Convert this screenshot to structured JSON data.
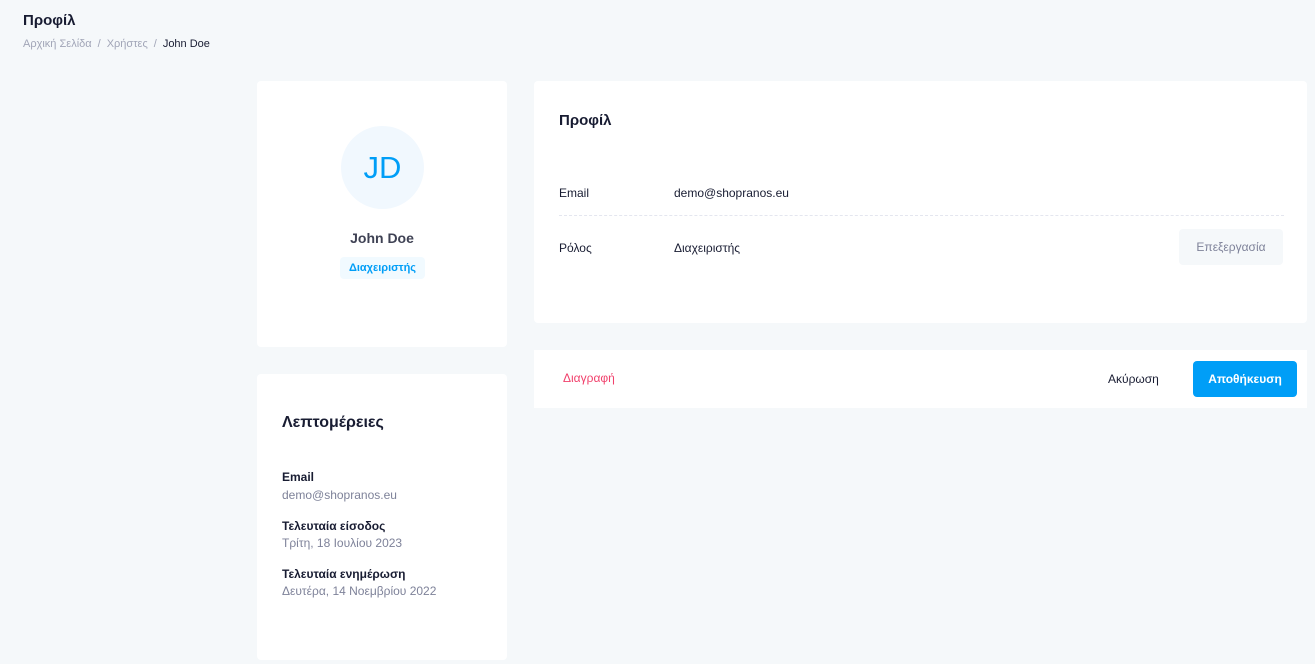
{
  "header": {
    "title": "Προφίλ",
    "breadcrumb": {
      "home": "Αρχική Σελίδα",
      "users": "Χρήστες",
      "current": "John Doe",
      "separator": "/"
    }
  },
  "user_card": {
    "initials": "JD",
    "name": "John Doe",
    "role_badge": "Διαχειριστής"
  },
  "details_card": {
    "title": "Λεπτομέρειες",
    "email_label": "Email",
    "email_value": "demo@shopranos.eu",
    "last_login_label": "Τελευταία είσοδος",
    "last_login_value": "Τρίτη, 18 Ιουλίου 2023",
    "last_update_label": "Τελευταία ενημέρωση",
    "last_update_value": "Δευτέρα, 14 Νοεμβρίου 2022"
  },
  "profile_card": {
    "title": "Προφίλ",
    "email_label": "Email",
    "email_value": "demo@shopranos.eu",
    "role_label": "Ρόλος",
    "role_value": "Διαχειριστής",
    "edit_label": "Επεξεργασία"
  },
  "actions": {
    "delete_label": "Διαγραφή",
    "cancel_label": "Ακύρωση",
    "save_label": "Αποθήκευση"
  },
  "colors": {
    "primary": "#009ef7",
    "danger": "#f1416c",
    "background": "#f5f8fa"
  }
}
